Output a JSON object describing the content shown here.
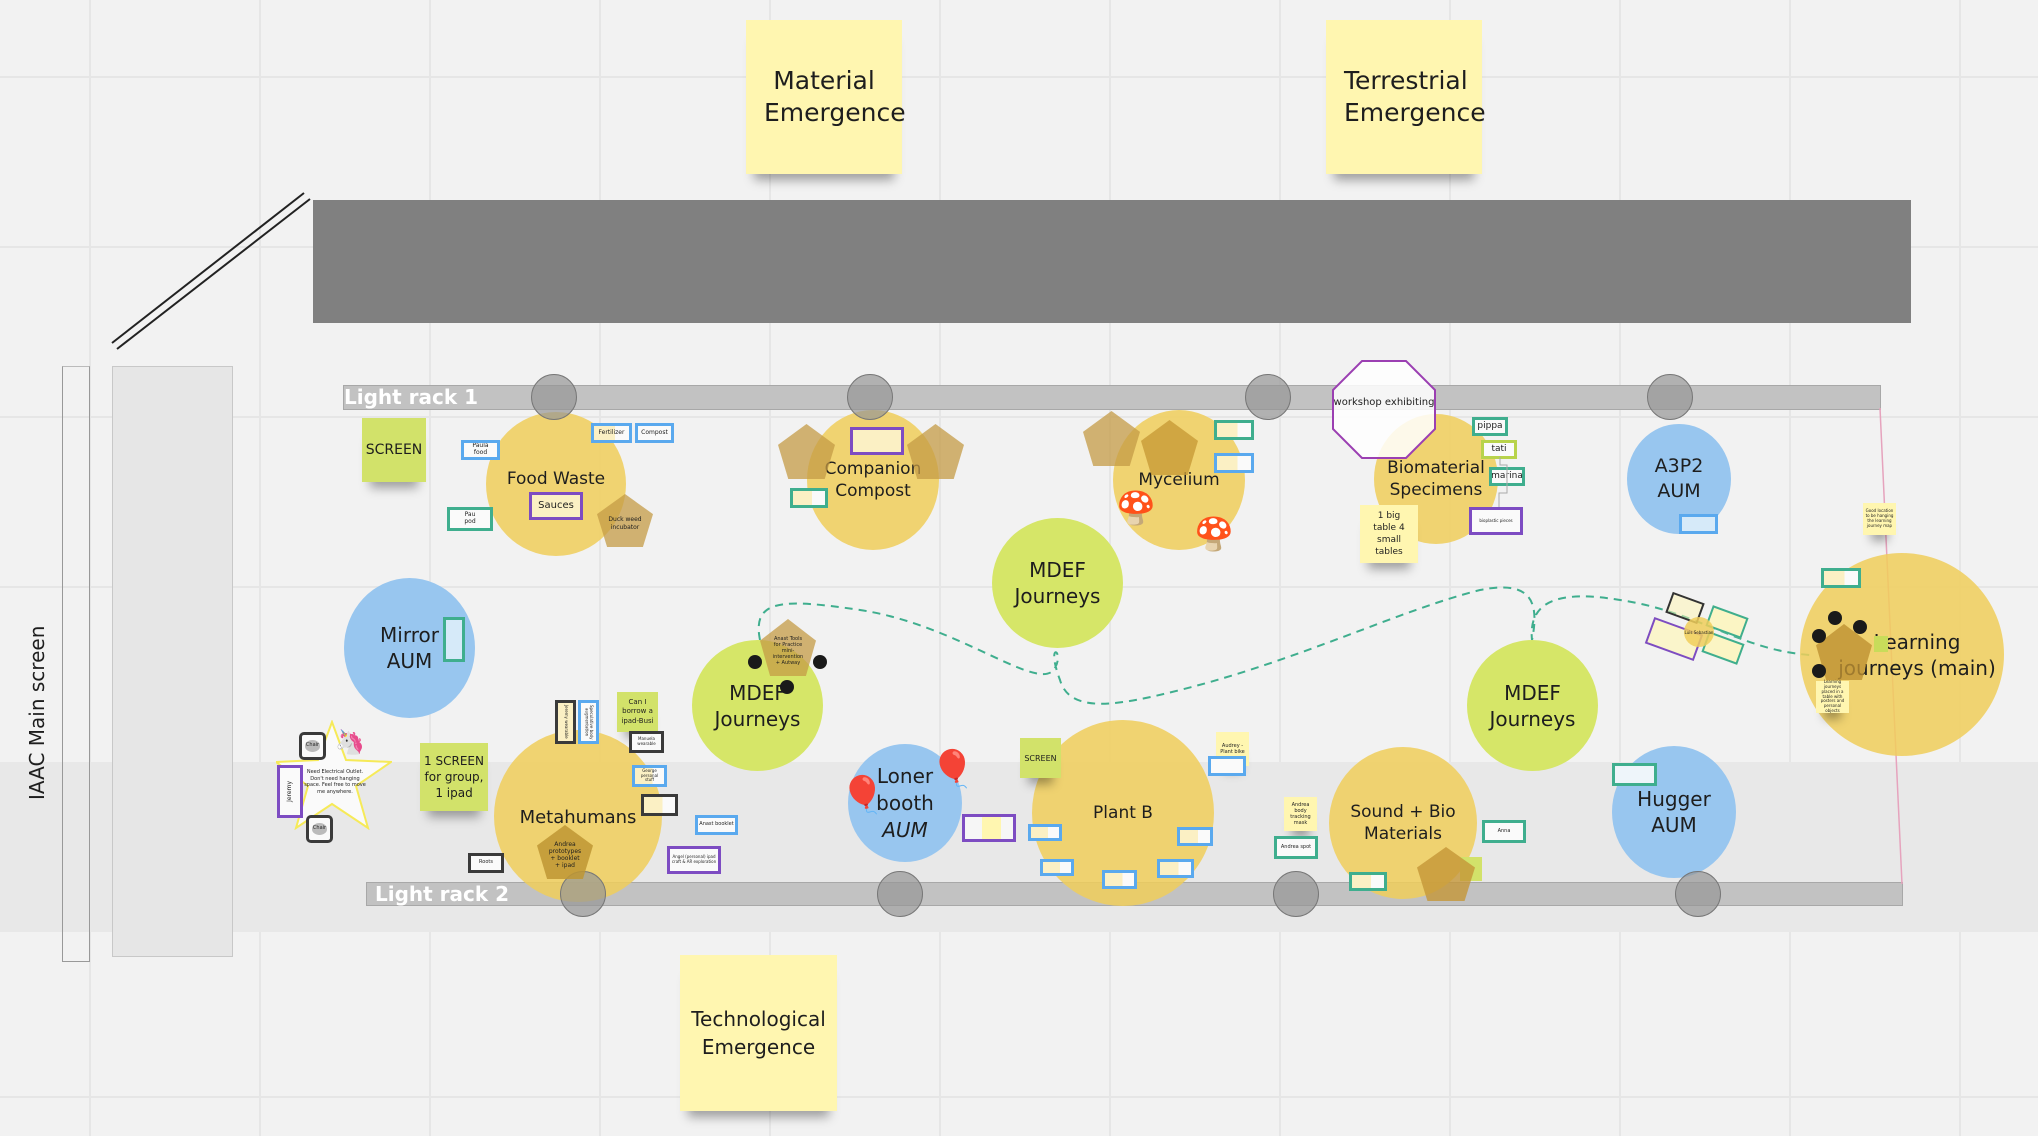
{
  "board": {
    "top_notes": {
      "material": "Material Emergence",
      "terrestrial": "Terrestrial Emergence",
      "technological": "Technological Emergence"
    },
    "main_screen_label": "IAAC Main screen",
    "racks": {
      "rack1": "Light rack 1",
      "rack2": "Light rack 2"
    },
    "zones": {
      "food_waste": "Food Waste",
      "companion_compost": "Companion Compost",
      "mycelium": "Mycelium",
      "biomaterial": "Biomaterial Specimens",
      "a3p2": "A3P2 AUM",
      "mirror": "Mirror AUM",
      "mdef_top": "MDEF Journeys",
      "mdef_left": "MDEF Journeys",
      "mdef_right": "MDEF Journeys",
      "learning": "Learning journeys (main)",
      "metahumans": "Metahumans",
      "loner_line1": "Loner",
      "loner_line2": "booth",
      "loner_line3": "AUM",
      "plant_b": "Plant B",
      "sound_bio": "Sound + Bio Materials",
      "hugger": "Hugger AUM"
    },
    "notes": {
      "screen_top": "SCREEN",
      "screen_plant": "SCREEN",
      "one_screen": "1 SCREEN for group, 1 ipad",
      "borrow_ipad": "Can I borrow a ipad-Busi",
      "big_table": "1 big table 4 small tables",
      "workshop": "workshop exhibiting",
      "audrey_plant": "Audrey - Plant bike",
      "andrea_tracking": "Andrea body tracking mask",
      "learning_note1": "Good location to be hanging the learning journey map",
      "learning_note2": "Learning journeys placed in a table with posters and personal objects"
    },
    "tags": {
      "sauces": "Sauces",
      "food_1": "Paula food",
      "food_2": "Fertilizer",
      "food_3": "Compost",
      "food_4": "Pau pod",
      "duck": "Duck weed incubator",
      "pippa": "pippa",
      "tati": "tati",
      "marina": "marina",
      "bio_extra": "bioplastic pieces",
      "jeremy": "Jeremy",
      "chair1": "Chair",
      "chair2": "Chair",
      "star_text": "Need Electrical Outlet. Don't need hanging space. Feel free to move me anywhere.",
      "roots": "Roots",
      "andrea_pent": "Andrea prototypes + booklet + ipad",
      "meta_v1": "Jeremy wearable",
      "meta_v2": "Speculative body augmentation",
      "meta_small": "Manuela wearable",
      "george": "George personal stuff",
      "anast_booklet": "Anast booklet",
      "angel": "Angel (personal) ipad craft & AR exploration",
      "anast_pent": "Anast Tools for Practice mini-intervention + Autway",
      "andrea_spot": "Andrea spot",
      "anna": "Anna",
      "cluster": "Luis Sebastian"
    },
    "icons": {
      "unicorn": "🦄",
      "mushroom": "🍄",
      "balloon": "🎈"
    },
    "colors": {
      "canvas": "#f2f2f2",
      "zone_yellow": "#f0ce5a",
      "zone_blue": "#98c6ef",
      "zone_green": "#d6e668",
      "sticky_yellow": "#fff6b0",
      "sticky_green": "#d2e26a",
      "dashed_path": "#3fae8e",
      "projector_bar": "#808080"
    }
  }
}
